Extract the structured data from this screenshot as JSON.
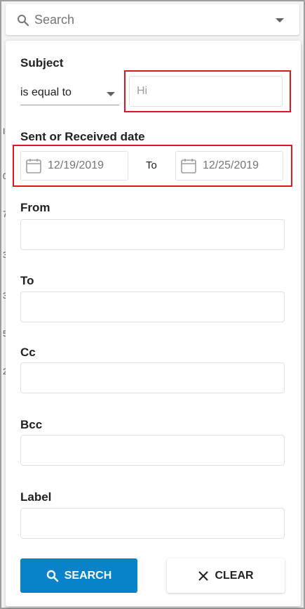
{
  "search": {
    "placeholder": "Search"
  },
  "form": {
    "subject": {
      "label": "Subject",
      "operator": "is equal to",
      "value": "Hi"
    },
    "date": {
      "label": "Sent or Received date",
      "from": "12/19/2019",
      "to_label": "To",
      "to": "12/25/2019"
    },
    "from": {
      "label": "From",
      "value": ""
    },
    "to": {
      "label": "To",
      "value": ""
    },
    "cc": {
      "label": "Cc",
      "value": ""
    },
    "bcc": {
      "label": "Bcc",
      "value": ""
    },
    "label": {
      "label": "Label",
      "value": ""
    }
  },
  "buttons": {
    "search": "SEARCH",
    "clear": "CLEAR"
  },
  "colors": {
    "primary": "#0883c9",
    "highlight": "#e0161f"
  },
  "background_marks": [
    "I",
    "0",
    "7",
    "3",
    "3",
    "5",
    "2"
  ]
}
